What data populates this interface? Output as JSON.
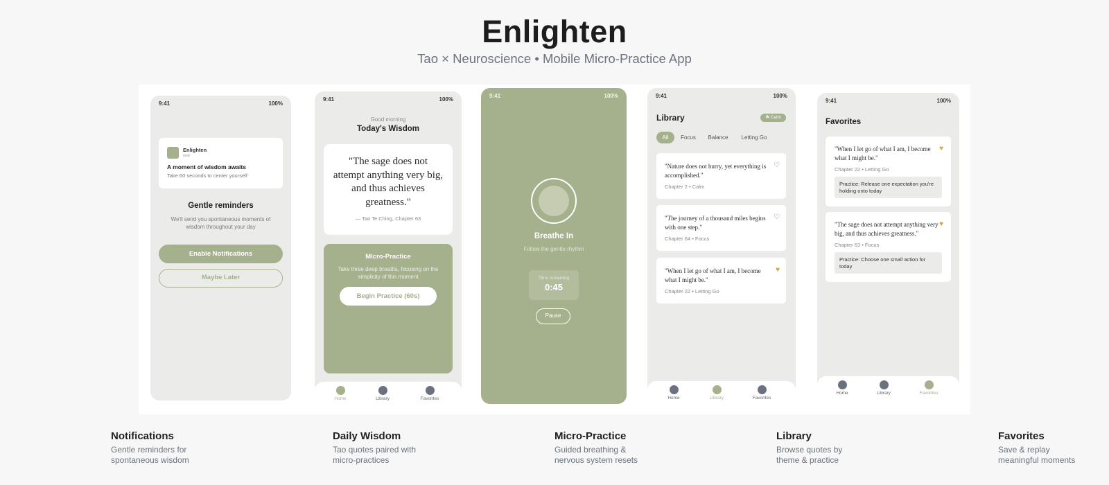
{
  "header": {
    "title": "Enlighten",
    "subtitle": "Tao × Neuroscience • Mobile Micro-Practice App"
  },
  "status_bar": {
    "time": "9:41",
    "battery": "100%"
  },
  "screen_notifications": {
    "app_name": "Enlighten",
    "app_time": "now",
    "notif_title": "A moment of wisdom awaits",
    "notif_body": "Take 60 seconds to center yourself",
    "heading": "Gentle reminders",
    "description": "We'll send you spontaneous moments of wisdom throughout your day",
    "enable_label": "Enable Notifications",
    "later_label": "Maybe Later"
  },
  "screen_wisdom": {
    "greeting": "Good morning",
    "title": "Today's Wisdom",
    "quote": "\"The sage does not attempt anything very big, and thus achieves greatness.\"",
    "source": "— Tao Te Ching, Chapter 63",
    "practice_title": "Micro-Practice",
    "practice_text": "Take three deep breaths, focusing on the simplicity of this moment",
    "practice_button": "Begin Practice (60s)"
  },
  "screen_practice": {
    "instruction": "Breathe In",
    "hint": "Follow the gentle rhythm",
    "timer_label": "Time remaining",
    "timer_value": "0:45",
    "pause_label": "Pause"
  },
  "screen_library": {
    "title": "Library",
    "badge": "Calm",
    "filters": [
      "All",
      "Focus",
      "Balance",
      "Letting Go"
    ],
    "items": [
      {
        "quote": "\"Nature does not hurry, yet everything is accomplished.\"",
        "meta": "Chapter 2 • Calm",
        "favorited": false
      },
      {
        "quote": "\"The journey of a thousand miles begins with one step.\"",
        "meta": "Chapter 64 • Focus",
        "favorited": false
      },
      {
        "quote": "\"When I let go of what I am, I become what I might be.\"",
        "meta": "Chapter 22 • Letting Go",
        "favorited": true
      }
    ]
  },
  "screen_favorites": {
    "title": "Favorites",
    "items": [
      {
        "quote": "\"When I let go of what I am, I become what I might be.\"",
        "meta": "Chapter 22 • Letting Go",
        "practice": "Practice: Release one expectation you're holding onto today"
      },
      {
        "quote": "\"The sage does not attempt anything very big, and thus achieves greatness.\"",
        "meta": "Chapter 63 • Focus",
        "practice": "Practice: Choose one small action for today"
      }
    ]
  },
  "tabs": {
    "home": "Home",
    "library": "Library",
    "favorites": "Favorites"
  },
  "captions": [
    {
      "title": "Notifications",
      "desc": "Gentle reminders for spontaneous wisdom"
    },
    {
      "title": "Daily Wisdom",
      "desc": "Tao quotes paired with micro-practices"
    },
    {
      "title": "Micro-Practice",
      "desc": "Guided breathing & nervous system resets"
    },
    {
      "title": "Library",
      "desc": "Browse quotes by theme & practice"
    },
    {
      "title": "Favorites",
      "desc": "Save & replay meaningful moments"
    }
  ],
  "colors": {
    "accent": "#a5b08c",
    "screen_bg": "#ebecea",
    "heart": "#c9a93a",
    "tab_inactive": "#6b7180"
  }
}
